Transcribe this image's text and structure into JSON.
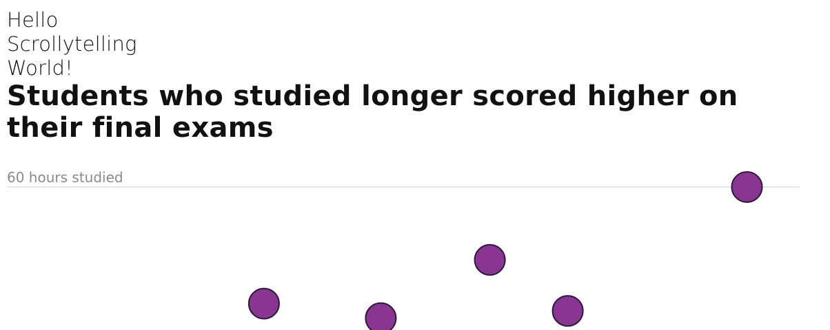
{
  "intro": {
    "line1": "Hello",
    "line2": "Scrollytelling",
    "line3": "World!"
  },
  "headline": "Students who studied longer scored higher on their final exams",
  "chart_data": {
    "type": "scatter",
    "title": "Students who studied longer scored higher on their final exams",
    "xlabel": "",
    "ylabel": "",
    "y_tick_label": "60 hours studied",
    "y_tick_value": 60,
    "ylim": [
      0,
      60
    ],
    "xlim": [
      0,
      100
    ],
    "grid": true,
    "points": [
      {
        "x": 95,
        "y": 60
      },
      {
        "x": 62,
        "y": 50
      },
      {
        "x": 33,
        "y": 44
      },
      {
        "x": 48,
        "y": 42
      },
      {
        "x": 72,
        "y": 43
      }
    ],
    "dot_color": "#8b3593"
  }
}
